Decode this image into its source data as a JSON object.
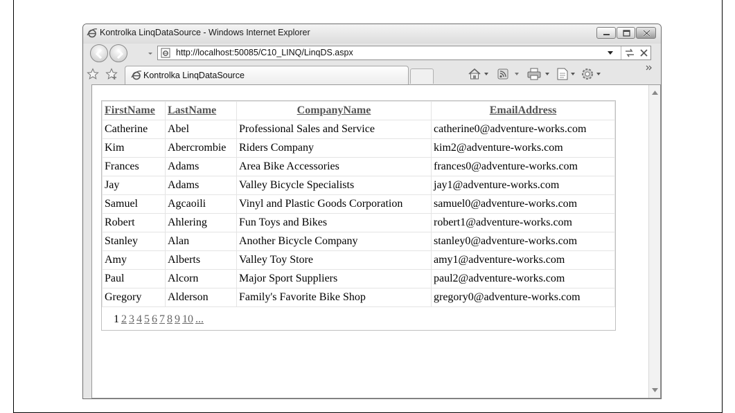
{
  "window": {
    "title": "Kontrolka LinqDataSource - Windows Internet Explorer"
  },
  "address": {
    "url": "http://localhost:50085/C10_LINQ/LinqDS.aspx"
  },
  "tabs": [
    {
      "label": "Kontrolka LinqDataSource"
    }
  ],
  "icons": {
    "window_buttons": [
      "minimize-icon",
      "restore-icon",
      "close-icon"
    ],
    "nav": [
      "back-icon",
      "forward-icon",
      "dropdown-icon"
    ],
    "address": [
      "ie-page-icon",
      "dropdown-icon",
      "refresh-icon",
      "stop-icon"
    ],
    "favorites": [
      "favorites-star-icon",
      "add-favorites-icon"
    ],
    "toolbar": [
      "home-icon",
      "feeds-icon",
      "print-icon",
      "page-icon",
      "tools-icon",
      "chevron-more-icon"
    ]
  },
  "grid": {
    "columns": [
      "FirstName",
      "LastName",
      "CompanyName",
      "EmailAddress"
    ],
    "rows": [
      [
        "Catherine",
        "Abel",
        "Professional Sales and Service",
        "catherine0@adventure-works.com"
      ],
      [
        "Kim",
        "Abercrombie",
        "Riders Company",
        "kim2@adventure-works.com"
      ],
      [
        "Frances",
        "Adams",
        "Area Bike Accessories",
        "frances0@adventure-works.com"
      ],
      [
        "Jay",
        "Adams",
        "Valley Bicycle Specialists",
        "jay1@adventure-works.com"
      ],
      [
        "Samuel",
        "Agcaoili",
        "Vinyl and Plastic Goods Corporation",
        "samuel0@adventure-works.com"
      ],
      [
        "Robert",
        "Ahlering",
        "Fun Toys and Bikes",
        "robert1@adventure-works.com"
      ],
      [
        "Stanley",
        "Alan",
        "Another Bicycle Company",
        "stanley0@adventure-works.com"
      ],
      [
        "Amy",
        "Alberts",
        "Valley Toy Store",
        "amy1@adventure-works.com"
      ],
      [
        "Paul",
        "Alcorn",
        "Major Sport Suppliers",
        "paul2@adventure-works.com"
      ],
      [
        "Gregory",
        "Alderson",
        "Family's Favorite Bike Shop",
        "gregory0@adventure-works.com"
      ]
    ],
    "pager": [
      "1",
      "2",
      "3",
      "4",
      "5",
      "6",
      "7",
      "8",
      "9",
      "10",
      "..."
    ],
    "current_page": "1"
  }
}
